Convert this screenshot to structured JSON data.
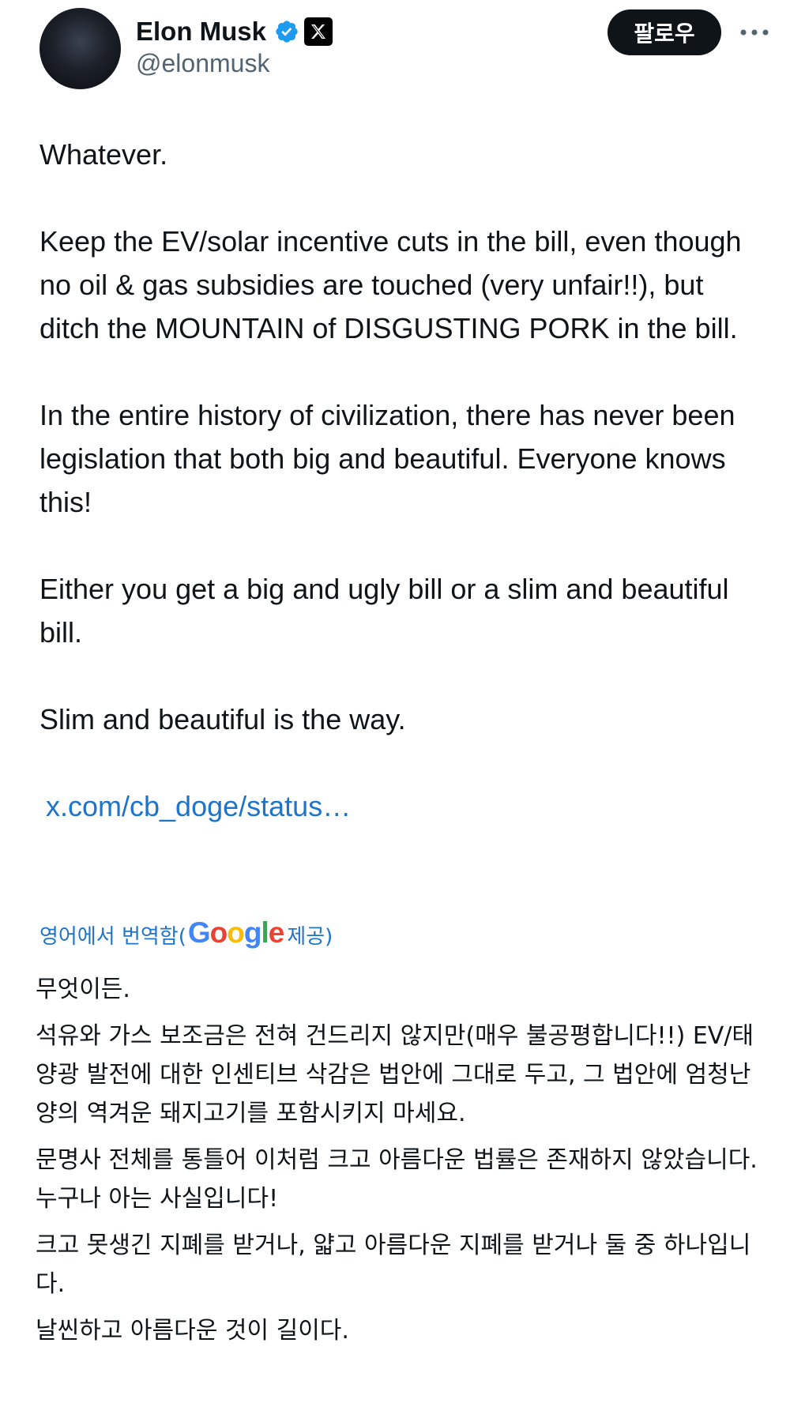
{
  "author": {
    "display_name": "Elon Musk",
    "handle": "@elonmusk",
    "verified_icon": "verified-badge-icon",
    "affiliate_icon": "x-logo-icon"
  },
  "header": {
    "follow_label": "팔로우",
    "more_icon": "more-dots-icon"
  },
  "tweet": {
    "paragraphs": [
      "Whatever.",
      "Keep the EV/solar incentive cuts in the bill, even though no oil & gas subsidies are touched (very unfair!!), but ditch the MOUNTAIN of DISGUSTING PORK in the bill.",
      "In the entire history of civilization, there has never been legislation that both big and beautiful. Everyone knows this!",
      "Either you get a big and ugly bill or a slim and beautiful bill.",
      "Slim and beautiful is the way."
    ],
    "link": "x.com/cb_doge/status…"
  },
  "translation": {
    "label_prefix": "영어에서 번역함(",
    "provider": "Google",
    "label_suffix": " 제공)",
    "paragraphs": [
      "무엇이든.",
      "석유와 가스 보조금은 전혀 건드리지 않지만(매우 불공평합니다!!) EV/태양광 발전에 대한 인센티브 삭감은 법안에 그대로 두고, 그 법안에 엄청난 양의 역겨운 돼지고기를 포함시키지 마세요.",
      "문명사 전체를 통틀어 이처럼 크고 아름다운 법률은 존재하지 않았습니다. 누구나 아는 사실입니다!",
      "크고 못생긴 지폐를 받거나, 얇고 아름다운 지폐를 받거나 둘 중 하나입니다.",
      "날씬하고 아름다운 것이 길이다."
    ]
  },
  "colors": {
    "link": "#1d74c8",
    "text": "#0f1419",
    "secondary": "#536471",
    "verified": "#1d9bf0",
    "google_blue": "#4285F4",
    "google_red": "#EA4335",
    "google_yellow": "#FBBC05",
    "google_green": "#34A853"
  }
}
